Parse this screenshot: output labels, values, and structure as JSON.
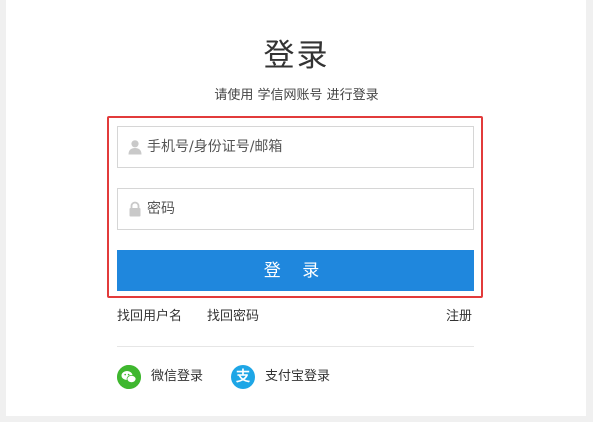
{
  "header": {
    "title": "登录",
    "subtitle": "请使用 学信网账号 进行登录"
  },
  "form": {
    "username_placeholder": "手机号/身份证号/邮箱",
    "password_placeholder": "密码",
    "login_button": "登 录"
  },
  "links": {
    "find_username": "找回用户名",
    "find_password": "找回密码",
    "register": "注册"
  },
  "social": {
    "wechat": {
      "label": "微信登录",
      "icon": "wechat-icon",
      "color": "#3fb72f"
    },
    "alipay": {
      "label": "支付宝登录",
      "icon": "alipay-icon",
      "color": "#1ea6e6",
      "glyph": "支"
    }
  },
  "colors": {
    "primary": "#1f87dd",
    "highlight_border": "#e23b3b"
  }
}
